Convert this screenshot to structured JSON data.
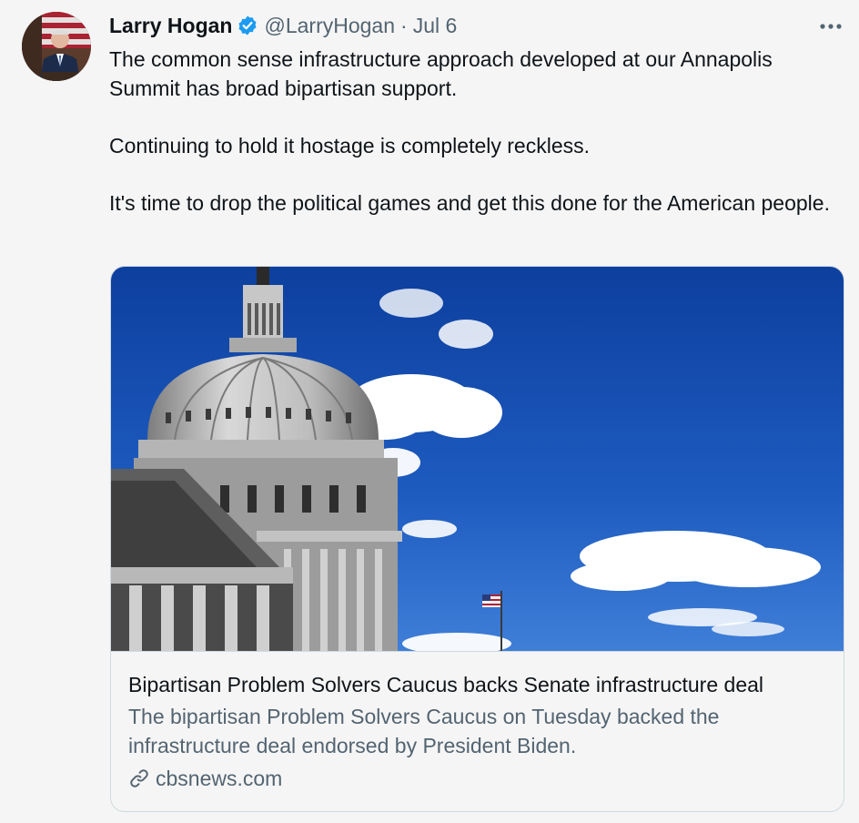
{
  "tweet": {
    "author_name": "Larry Hogan",
    "handle": "@LarryHogan",
    "separator": "·",
    "date": "Jul 6",
    "verified": true,
    "paragraphs": [
      "The common sense infrastructure approach developed at our Annapolis Summit has broad bipartisan support.",
      "Continuing to hold it hostage is completely reckless.",
      "It's time to drop the political games and get this done for the American people."
    ]
  },
  "card": {
    "title": "Bipartisan Problem Solvers Caucus backs Senate infrastructure deal",
    "description": "The bipartisan Problem Solvers Caucus on Tuesday backed the infrastructure deal endorsed by President Biden.",
    "domain": "cbsnews.com"
  },
  "icons": {
    "verified": "verified-badge-icon",
    "more": "more-options-icon",
    "link": "link-icon"
  },
  "colors": {
    "verified_blue": "#1d9bf0",
    "secondary_text": "#536471",
    "primary_text": "#0f1419",
    "card_border": "#cfd9de",
    "sky": "#1f5fbf"
  }
}
